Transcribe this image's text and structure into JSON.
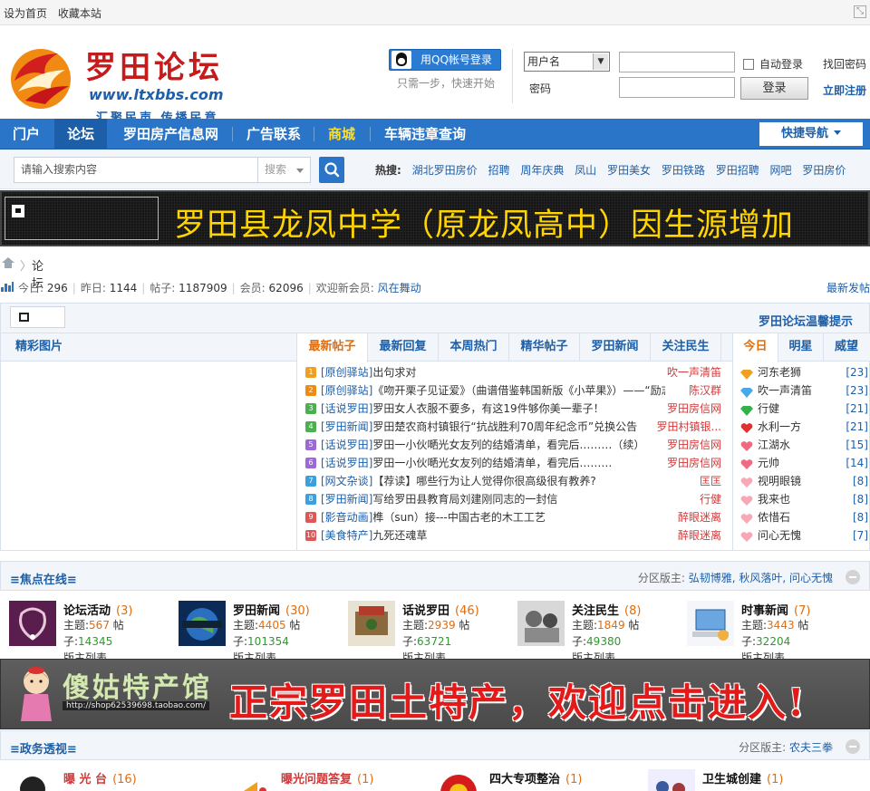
{
  "topbar": {
    "set_home": "设为首页",
    "bookmark": "收藏本站"
  },
  "logo": {
    "name": "罗田论坛",
    "url": "www.ltxbbs.com",
    "slogan": "汇聚民声 传播民意"
  },
  "login": {
    "qq_button": "用QQ帐号登录",
    "qq_tip": "只需一步，快速开始",
    "user_select": "用户名",
    "password_label": "密码",
    "auto_login": "自动登录",
    "login_button": "登录",
    "find_password": "找回密码",
    "register": "立即注册"
  },
  "nav": {
    "items": [
      "门户",
      "论坛",
      "罗田房产信息网",
      "广告联系",
      "商城",
      "车辆违章查询"
    ],
    "quick_nav": "快捷导航"
  },
  "search": {
    "placeholder": "请输入搜索内容",
    "type": "搜索",
    "hot_label": "热搜:",
    "hot_words": [
      "湖北罗田房价",
      "招聘",
      "周年庆典",
      "凤山",
      "罗田美女",
      "罗田铁路",
      "罗田招聘",
      "网吧",
      "罗田房价"
    ]
  },
  "marquee": {
    "text": "罗田县龙凤中学（原龙凤高中）因生源增加"
  },
  "breadcrumb": {
    "current": "论坛"
  },
  "stats": {
    "today_label": "今日:",
    "today": "296",
    "yesterday_label": "昨日:",
    "yesterday": "1144",
    "posts_label": "帖子:",
    "posts": "1187909",
    "members_label": "会员:",
    "members": "62096",
    "welcome_label": "欢迎新会员:",
    "new_member": "风在舞动",
    "latest_posts": "最新发帖"
  },
  "notice": {
    "tip": "罗田论坛温馨提示"
  },
  "pics": {
    "title": "精彩图片"
  },
  "post_tabs": [
    "最新帖子",
    "最新回复",
    "本周热门",
    "精华帖子",
    "罗田新闻",
    "关注民生"
  ],
  "posts": [
    {
      "n": "1",
      "cat": "[原创驿站]",
      "title": "出句求对",
      "author": "吹一声清笛"
    },
    {
      "n": "2",
      "cat": "[原创驿站]",
      "title": "《吻开栗子见证爱》（曲谱借鉴韩国新版《小苹果》）——“励志",
      "author": "陈汉群"
    },
    {
      "n": "3",
      "cat": "[话说罗田]",
      "title": "罗田女人衣服不要多，有这19件够你美一辈子！",
      "author": "罗田房信网"
    },
    {
      "n": "4",
      "cat": "[罗田新闻]",
      "title": "罗田楚农商村镇银行“抗战胜利70周年纪念币”兑换公告",
      "author": "罗田村镇银..."
    },
    {
      "n": "5",
      "cat": "[话说罗田]",
      "title": "罗田一小伙嗮光女友列的结婚清单，看完后………（续）",
      "author": "罗田房信网"
    },
    {
      "n": "6",
      "cat": "[话说罗田]",
      "title": "罗田一小伙嗮光女友列的结婚清单，看完后………",
      "author": "罗田房信网"
    },
    {
      "n": "7",
      "cat": "[网文杂谈]",
      "title": "【荐读】哪些行为让人觉得你很高级很有教养?",
      "author": "匡匡"
    },
    {
      "n": "8",
      "cat": "[罗田新闻]",
      "title": "写给罗田县教育局刘建刚同志的一封信",
      "author": "行健"
    },
    {
      "n": "9",
      "cat": "[影音动画]",
      "title": "榫（sun）接---中国古老的木工工艺",
      "author": "醉眼迷离"
    },
    {
      "n": "10",
      "cat": "[美食特产]",
      "title": "九死还魂草",
      "author": "醉眼迷离"
    }
  ],
  "rank_tabs": [
    "今日",
    "明星",
    "威望"
  ],
  "ranks": [
    {
      "name": "河东老狮",
      "count": "[23]",
      "icon": "diamond-orange"
    },
    {
      "name": "吹一声清笛",
      "count": "[23]",
      "icon": "diamond-blue"
    },
    {
      "name": "行健",
      "count": "[21]",
      "icon": "diamond-green"
    },
    {
      "name": "水利一方",
      "count": "[21]",
      "icon": "heart-red"
    },
    {
      "name": "江湖水",
      "count": "[15]",
      "icon": "heart-pink"
    },
    {
      "name": "元帅",
      "count": "[14]",
      "icon": "heart-pink"
    },
    {
      "name": "视明眼镜",
      "count": "[8]",
      "icon": "heart-light"
    },
    {
      "name": "我来也",
      "count": "[8]",
      "icon": "heart-light"
    },
    {
      "name": "侬惜石",
      "count": "[8]",
      "icon": "heart-light"
    },
    {
      "name": "问心无愧",
      "count": "[7]",
      "icon": "heart-light"
    }
  ],
  "focus": {
    "title": "≡焦点在线≡",
    "mods_label": "分区版主:",
    "mods": "弘韧博雅, 秋风落叶, 问心无愧",
    "forums": [
      {
        "name": "论坛活动",
        "count": "(3)",
        "topics": "567",
        "posts": "14345",
        "mod": "版主列表"
      },
      {
        "name": "罗田新闻",
        "count": "(30)",
        "topics": "4405",
        "posts": "101354",
        "mod": "版主列表"
      },
      {
        "name": "话说罗田",
        "count": "(46)",
        "topics": "2939",
        "posts": "63721",
        "mod": "版主列表"
      },
      {
        "name": "关注民生",
        "count": "(8)",
        "topics": "1849",
        "posts": "49380",
        "mod": "版主列表"
      },
      {
        "name": "时事新闻",
        "count": "(7)",
        "topics": "3443",
        "posts": "32204",
        "mod": "版主列表"
      }
    ]
  },
  "ad": {
    "shop": "傻姑特产馆",
    "url": "http://shop62539698.taobao.com/",
    "slogan": "正宗罗田土特产，欢迎点击进入!"
  },
  "gov": {
    "title": "≡政务透视≡",
    "mods_label": "分区版主:",
    "mods": "农夫三拳",
    "forums": [
      {
        "name": "曝 光 台",
        "count": "(16)"
      },
      {
        "name": "曝光问题答复",
        "count": "(1)"
      },
      {
        "name": "四大专项整治",
        "count": "(1)"
      },
      {
        "name": "卫生城创建",
        "count": "(1)"
      }
    ]
  },
  "labels": {
    "topics": "主题:",
    "posts": "帖子:"
  },
  "colors": {
    "nav_blue": "#2a75c8",
    "link_blue": "#1d5fa8",
    "orange": "#e46c0a",
    "red": "#d23a3a",
    "green": "#2e9a2e"
  }
}
